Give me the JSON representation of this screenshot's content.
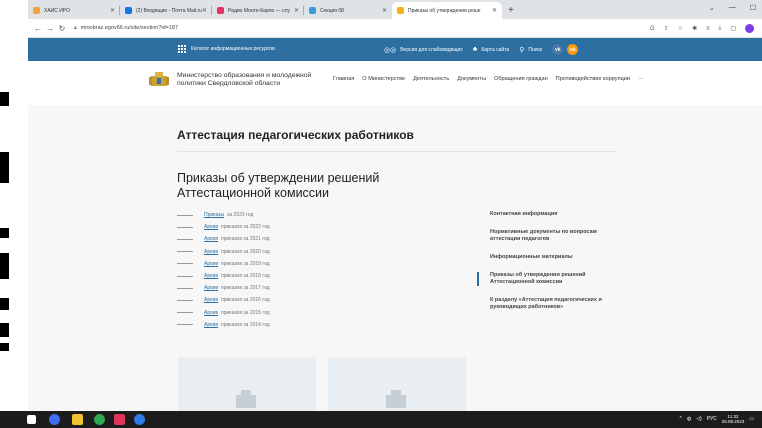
{
  "browser": {
    "tabs": [
      {
        "label": "ХАИС ИРО",
        "favicon_color": "#f2a33a",
        "active": false
      },
      {
        "label": "(2) Входящие - Почта Mail.ru",
        "favicon_color": "#1a73e8",
        "active": false
      },
      {
        "label": "Радио Монте-Карло — слу",
        "favicon_color": "#e0325e",
        "active": false
      },
      {
        "label": "Секция 08",
        "favicon_color": "#3a9bd8",
        "active": false
      },
      {
        "label": "Приказы об утверждении реше",
        "favicon_color": "#f2b01e",
        "active": true
      }
    ],
    "new_tab": "+",
    "url": "minobraz.egov66.ru/site/section?id=187"
  },
  "topbar": {
    "catalog": "Каталог информационных ресурсов",
    "accessibility": "Версия для слабовидящих",
    "sitemap": "Карта сайта",
    "search": "Поиск",
    "social_vk": "vk",
    "social_ok": "ok"
  },
  "header": {
    "ministry": "Министерство образования и молодежной политики Свердловской области",
    "nav": [
      "Главная",
      "О Министерстве",
      "Деятельность",
      "Документы",
      "Обращения граждан",
      "Противодействие коррупции",
      "···"
    ]
  },
  "main": {
    "section_title": "Аттестация педагогических работников",
    "page_title": "Приказы об утверждении решений Аттестационной комиссии",
    "orders": [
      {
        "link": "Приказы",
        "text": "за 2023 год"
      },
      {
        "link": "Архив",
        "text": "приказов за 2022 год"
      },
      {
        "link": "Архив",
        "text": "приказов за 2021 год"
      },
      {
        "link": "Архив",
        "text": "приказов за 2020 год"
      },
      {
        "link": "Архив",
        "text": "приказов за 2019 год"
      },
      {
        "link": "Архив",
        "text": "приказов за 2018 год"
      },
      {
        "link": "Архив",
        "text": "приказов за 2017 год"
      },
      {
        "link": "Архив",
        "text": "приказов за 2016 год"
      },
      {
        "link": "Архив",
        "text": "приказов за 2015 год"
      },
      {
        "link": "Архив",
        "text": "приказов за 2014 год"
      }
    ],
    "sidenav": [
      {
        "label": "Контактная информация",
        "active": false
      },
      {
        "label": "Нормативные документы по вопросам аттестации педагогов",
        "active": false
      },
      {
        "label": "Информационные материалы",
        "active": false
      },
      {
        "label": "Приказы об утверждении решений Аттестационной комиссии",
        "active": true
      },
      {
        "label": "К разделу «Аттестация педагогических и руководящих работников»",
        "active": false
      }
    ]
  },
  "taskbar": {
    "lang": "РУС",
    "time": "11:32",
    "date": "25.08.2023"
  },
  "colors": {
    "brand_blue": "#2d6fa1",
    "vk": "#4a76a8",
    "ok": "#f59a12"
  }
}
